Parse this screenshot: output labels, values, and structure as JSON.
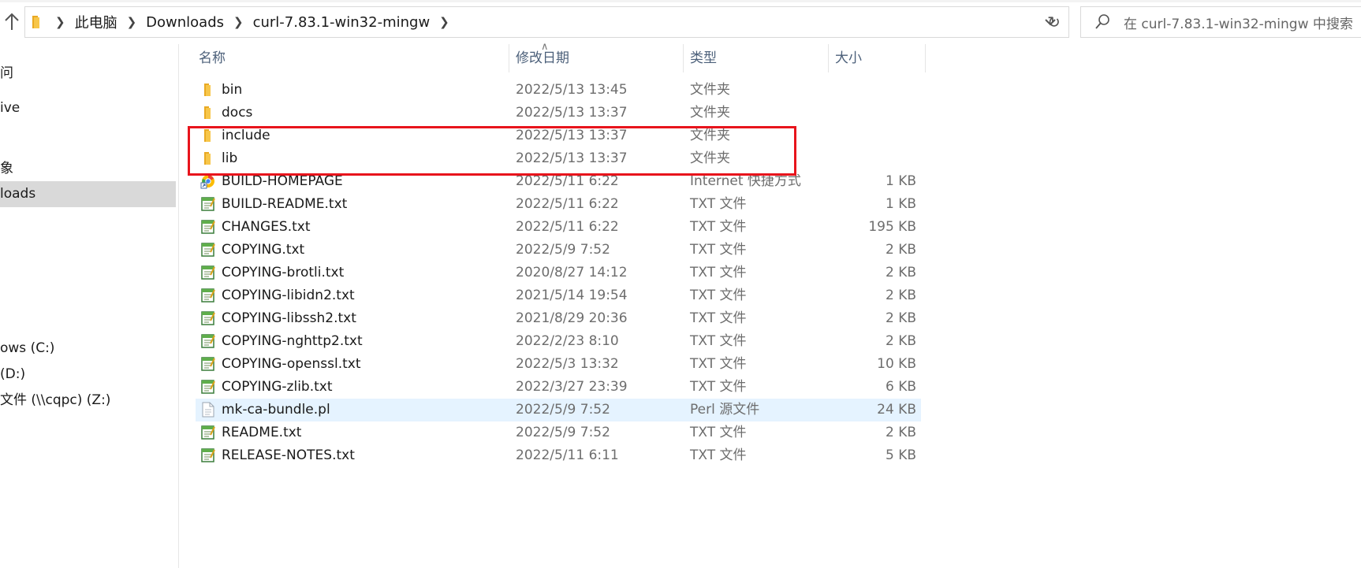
{
  "address": {
    "breadcrumbs": [
      "此电脑",
      "Downloads",
      "curl-7.83.1-win32-mingw"
    ]
  },
  "search": {
    "placeholder": "在 curl-7.83.1-win32-mingw 中搜索"
  },
  "nav": {
    "items": [
      {
        "label": "问"
      },
      {
        "label": "ive"
      },
      {
        "label": "象"
      },
      {
        "label": "loads",
        "selected": true
      },
      {
        "label": "ows (C:)"
      },
      {
        "label": "(D:)"
      },
      {
        "label": "文件 (\\\\cqpc) (Z:)"
      }
    ]
  },
  "columns": {
    "name": "名称",
    "date": "修改日期",
    "type": "类型",
    "size": "大小"
  },
  "files": [
    {
      "name": "bin",
      "date": "2022/5/13 13:45",
      "type": "文件夹",
      "size": "",
      "icon": "folder-icon"
    },
    {
      "name": "docs",
      "date": "2022/5/13 13:37",
      "type": "文件夹",
      "size": "",
      "icon": "folder-icon"
    },
    {
      "name": "include",
      "date": "2022/5/13 13:37",
      "type": "文件夹",
      "size": "",
      "icon": "folder-icon"
    },
    {
      "name": "lib",
      "date": "2022/5/13 13:37",
      "type": "文件夹",
      "size": "",
      "icon": "folder-icon"
    },
    {
      "name": "BUILD-HOMEPAGE",
      "date": "2022/5/11 6:22",
      "type": "Internet 快捷方式",
      "size": "1 KB",
      "icon": "internet-shortcut-icon"
    },
    {
      "name": "BUILD-README.txt",
      "date": "2022/5/11 6:22",
      "type": "TXT 文件",
      "size": "1 KB",
      "icon": "text-file-icon"
    },
    {
      "name": "CHANGES.txt",
      "date": "2022/5/11 6:22",
      "type": "TXT 文件",
      "size": "195 KB",
      "icon": "text-file-icon"
    },
    {
      "name": "COPYING.txt",
      "date": "2022/5/9 7:52",
      "type": "TXT 文件",
      "size": "2 KB",
      "icon": "text-file-icon"
    },
    {
      "name": "COPYING-brotli.txt",
      "date": "2020/8/27 14:12",
      "type": "TXT 文件",
      "size": "2 KB",
      "icon": "text-file-icon"
    },
    {
      "name": "COPYING-libidn2.txt",
      "date": "2021/5/14 19:54",
      "type": "TXT 文件",
      "size": "2 KB",
      "icon": "text-file-icon"
    },
    {
      "name": "COPYING-libssh2.txt",
      "date": "2021/8/29 20:36",
      "type": "TXT 文件",
      "size": "2 KB",
      "icon": "text-file-icon"
    },
    {
      "name": "COPYING-nghttp2.txt",
      "date": "2022/2/23 8:10",
      "type": "TXT 文件",
      "size": "2 KB",
      "icon": "text-file-icon"
    },
    {
      "name": "COPYING-openssl.txt",
      "date": "2022/5/3 13:32",
      "type": "TXT 文件",
      "size": "10 KB",
      "icon": "text-file-icon"
    },
    {
      "name": "COPYING-zlib.txt",
      "date": "2022/3/27 23:39",
      "type": "TXT 文件",
      "size": "6 KB",
      "icon": "text-file-icon"
    },
    {
      "name": "mk-ca-bundle.pl",
      "date": "2022/5/9 7:52",
      "type": "Perl 源文件",
      "size": "24 KB",
      "icon": "perl-file-icon",
      "hovered": true
    },
    {
      "name": "README.txt",
      "date": "2022/5/9 7:52",
      "type": "TXT 文件",
      "size": "2 KB",
      "icon": "text-file-icon"
    },
    {
      "name": "RELEASE-NOTES.txt",
      "date": "2022/5/11 6:11",
      "type": "TXT 文件",
      "size": "5 KB",
      "icon": "text-file-icon"
    }
  ],
  "colors": {
    "highlight_box": "#e8141c",
    "hover_row": "#e5f3ff",
    "selected_nav": "#d9d9d9",
    "folder": "#f7c64a"
  }
}
